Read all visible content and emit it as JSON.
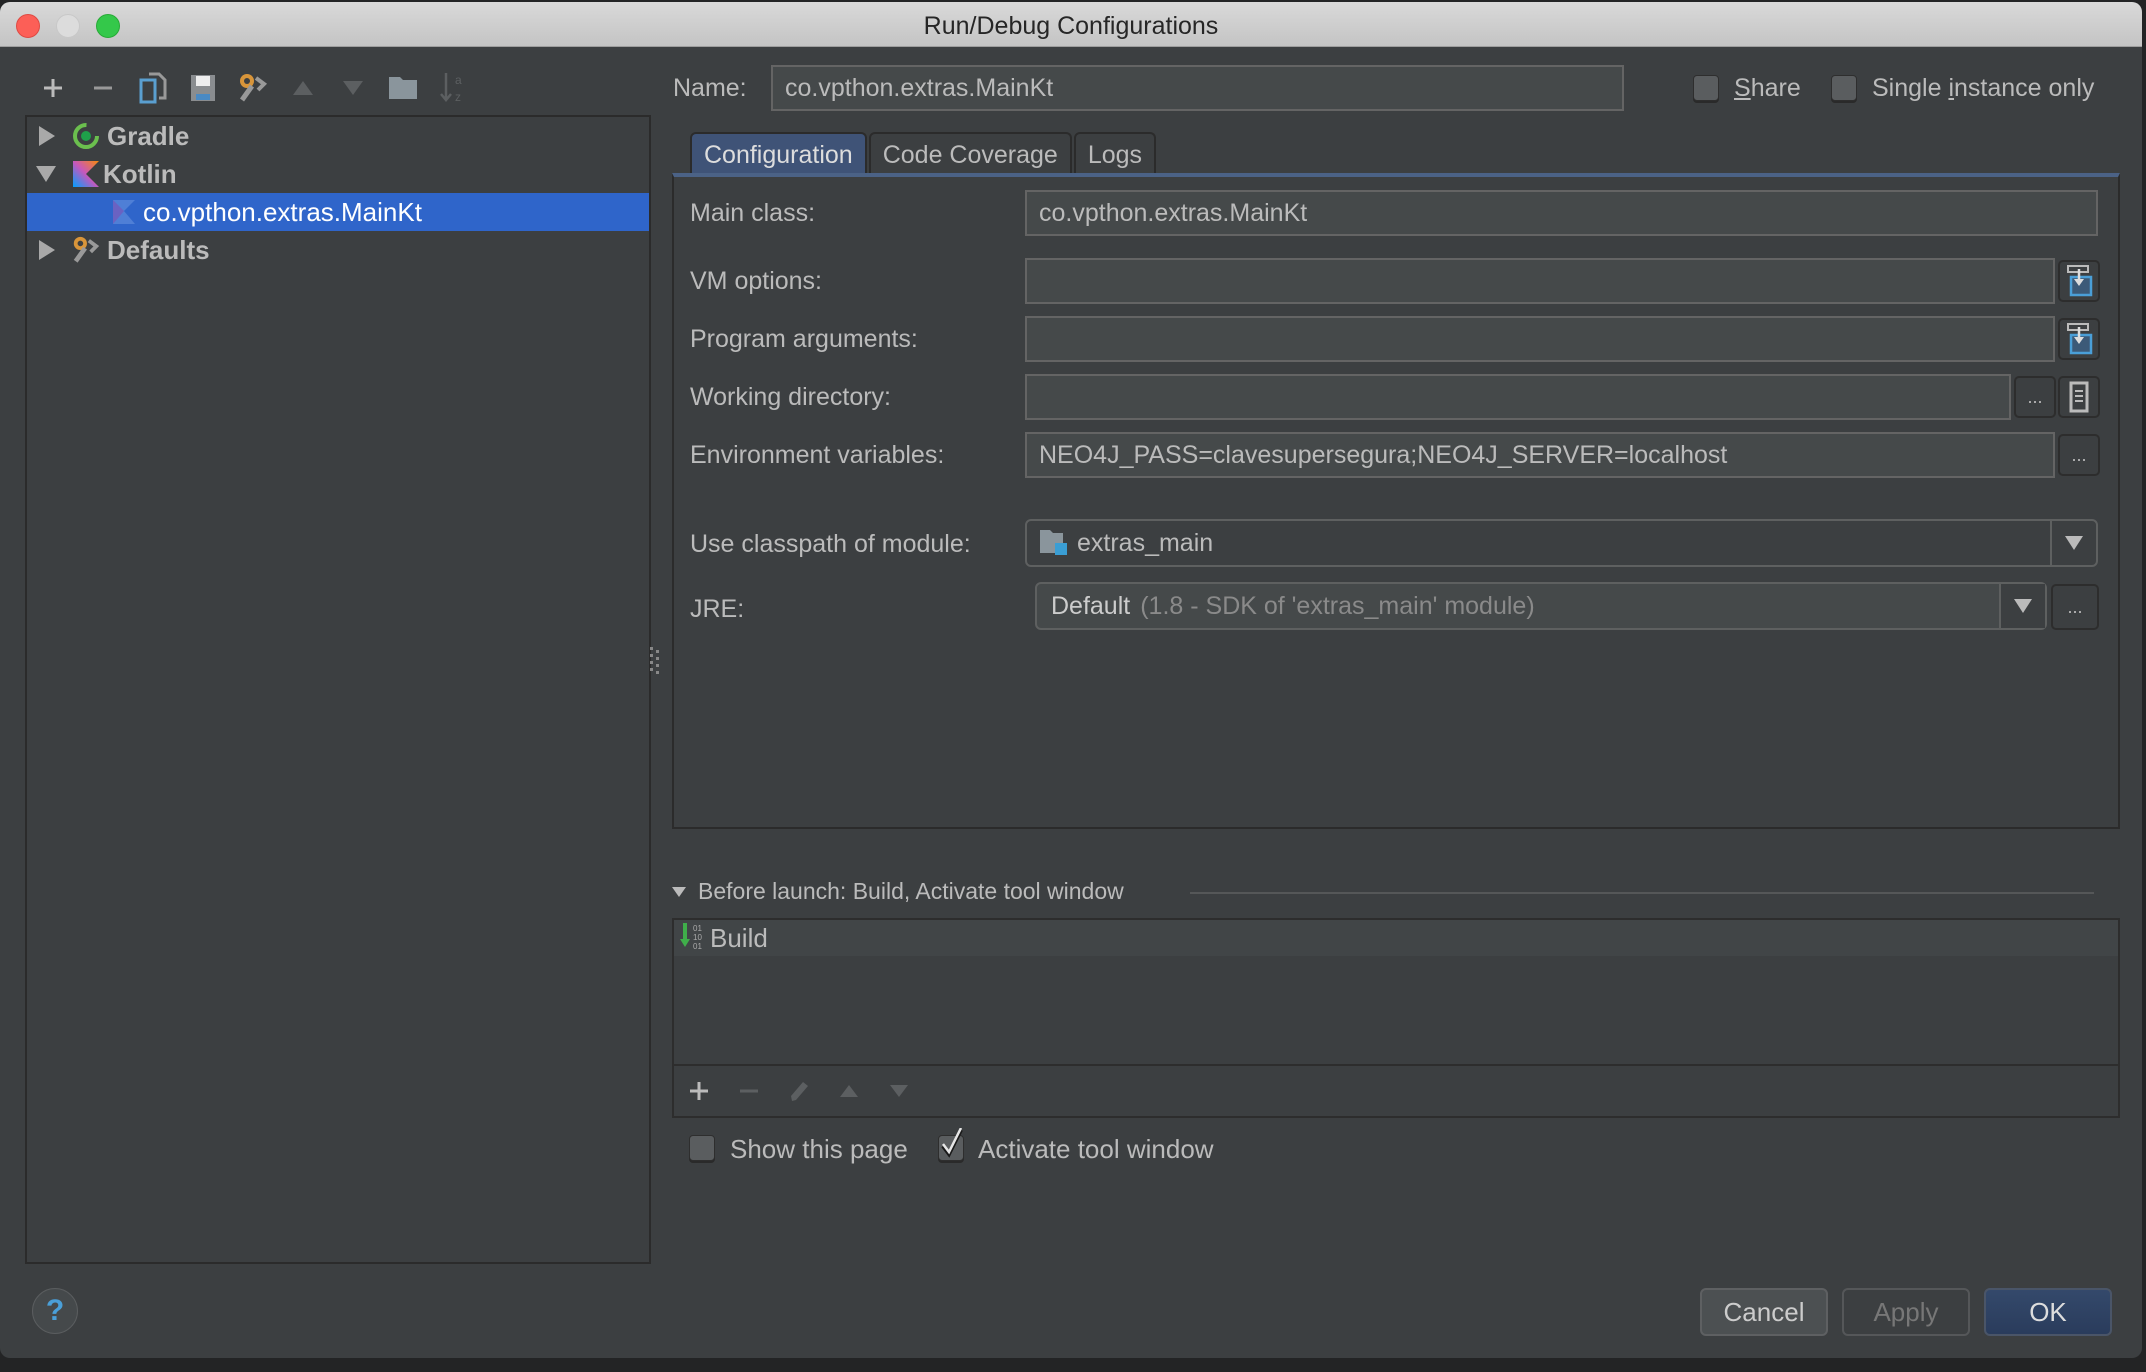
{
  "window": {
    "title": "Run/Debug Configurations"
  },
  "sidebar": {
    "toolbar": [
      {
        "name": "add-icon",
        "enabled": true
      },
      {
        "name": "remove-icon",
        "enabled": true
      },
      {
        "name": "copy-icon",
        "enabled": true
      },
      {
        "name": "save-icon",
        "enabled": true
      },
      {
        "name": "edit-defaults-icon",
        "enabled": true
      },
      {
        "name": "move-up-icon",
        "enabled": false
      },
      {
        "name": "move-down-icon",
        "enabled": false
      },
      {
        "name": "folder-icon",
        "enabled": true
      },
      {
        "name": "sort-icon",
        "enabled": false
      }
    ],
    "tree": [
      {
        "label": "Gradle",
        "icon": "gradle-icon",
        "expanded": false,
        "level": 0
      },
      {
        "label": "Kotlin",
        "icon": "kotlin-icon",
        "expanded": true,
        "level": 0
      },
      {
        "label": "co.vpthon.extras.MainKt",
        "icon": "kotlin-file-icon",
        "selected": true,
        "level": 1
      },
      {
        "label": "Defaults",
        "icon": "wrench-icon",
        "expanded": false,
        "level": 0
      }
    ]
  },
  "header": {
    "name_label": "Name:",
    "name_value": "co.vpthon.extras.MainKt",
    "share_label": "Share",
    "share_checked": false,
    "single_instance_label": "Single instance only",
    "single_instance_checked": false
  },
  "tabs": [
    {
      "label": "Configuration",
      "active": true
    },
    {
      "label": "Code Coverage",
      "active": false
    },
    {
      "label": "Logs",
      "active": false
    }
  ],
  "config": {
    "main_class_label": "Main class:",
    "main_class_value": "co.vpthon.extras.MainKt",
    "vm_options_label": "VM options:",
    "vm_options_value": "",
    "program_args_label": "Program arguments:",
    "program_args_value": "",
    "working_dir_label": "Working directory:",
    "working_dir_value": "",
    "env_vars_label": "Environment variables:",
    "env_vars_value": "NEO4J_PASS=clavesupersegura;NEO4J_SERVER=localhost",
    "classpath_label": "Use classpath of module:",
    "classpath_value": "extras_main",
    "jre_label": "JRE:",
    "jre_value": "Default",
    "jre_detail": "(1.8 - SDK of 'extras_main' module)",
    "ellipsis": "..."
  },
  "before_launch": {
    "header": "Before launch: Build, Activate tool window",
    "items": [
      {
        "label": "Build",
        "icon": "build-icon"
      }
    ],
    "show_page_label": "Show this page",
    "show_page_checked": false,
    "activate_tool_label": "Activate tool window",
    "activate_tool_checked": true
  },
  "footer": {
    "help": "?",
    "cancel": "Cancel",
    "apply": "Apply",
    "ok": "OK"
  },
  "colors": {
    "dialog_bg": "#3c3f41",
    "selection": "#2f65ca",
    "active_tab": "#3f5377",
    "ok_button": "#2e4365",
    "field_bg": "#45494a"
  }
}
